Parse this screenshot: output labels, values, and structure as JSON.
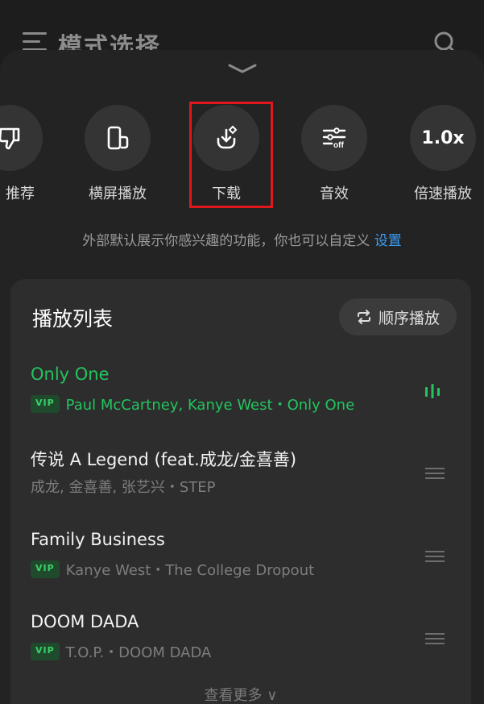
{
  "background": {
    "title": "模式选择",
    "menu_icon": "menu-icon",
    "search_icon": "search-icon"
  },
  "actions": [
    {
      "label": "推荐",
      "icon": "thumb-down-icon"
    },
    {
      "label": "横屏播放",
      "icon": "landscape-phone-icon"
    },
    {
      "label": "下载",
      "icon": "download-icon"
    },
    {
      "label": "音效",
      "icon": "sound-effect-off-icon"
    },
    {
      "label": "倍速播放",
      "icon": "speed-icon",
      "value": "1.0x"
    }
  ],
  "hint": {
    "text": "外部默认展示你感兴趣的功能，你也可以自定义",
    "link": "设置"
  },
  "playlist": {
    "title": "播放列表",
    "mode": "顺序播放",
    "tracks": [
      {
        "title": "Only One",
        "vip": "VIP",
        "subtitle": "Paul McCartney, Kanye West・Only One",
        "playing": true
      },
      {
        "title": "传说 A Legend (feat.成龙/金喜善)",
        "vip": "",
        "subtitle": "成龙, 金喜善, 张艺兴・STEP",
        "playing": false
      },
      {
        "title": "Family Business",
        "vip": "VIP",
        "subtitle": "Kanye West・The College Dropout",
        "playing": false
      },
      {
        "title": "DOOM DADA",
        "vip": "VIP",
        "subtitle": "T.O.P.・DOOM DADA",
        "playing": false
      }
    ],
    "see_more": "查看更多 ∨"
  },
  "colors": {
    "accent_green": "#22c55e",
    "link_blue": "#3a9ff5",
    "highlight_red": "#e0171b"
  }
}
